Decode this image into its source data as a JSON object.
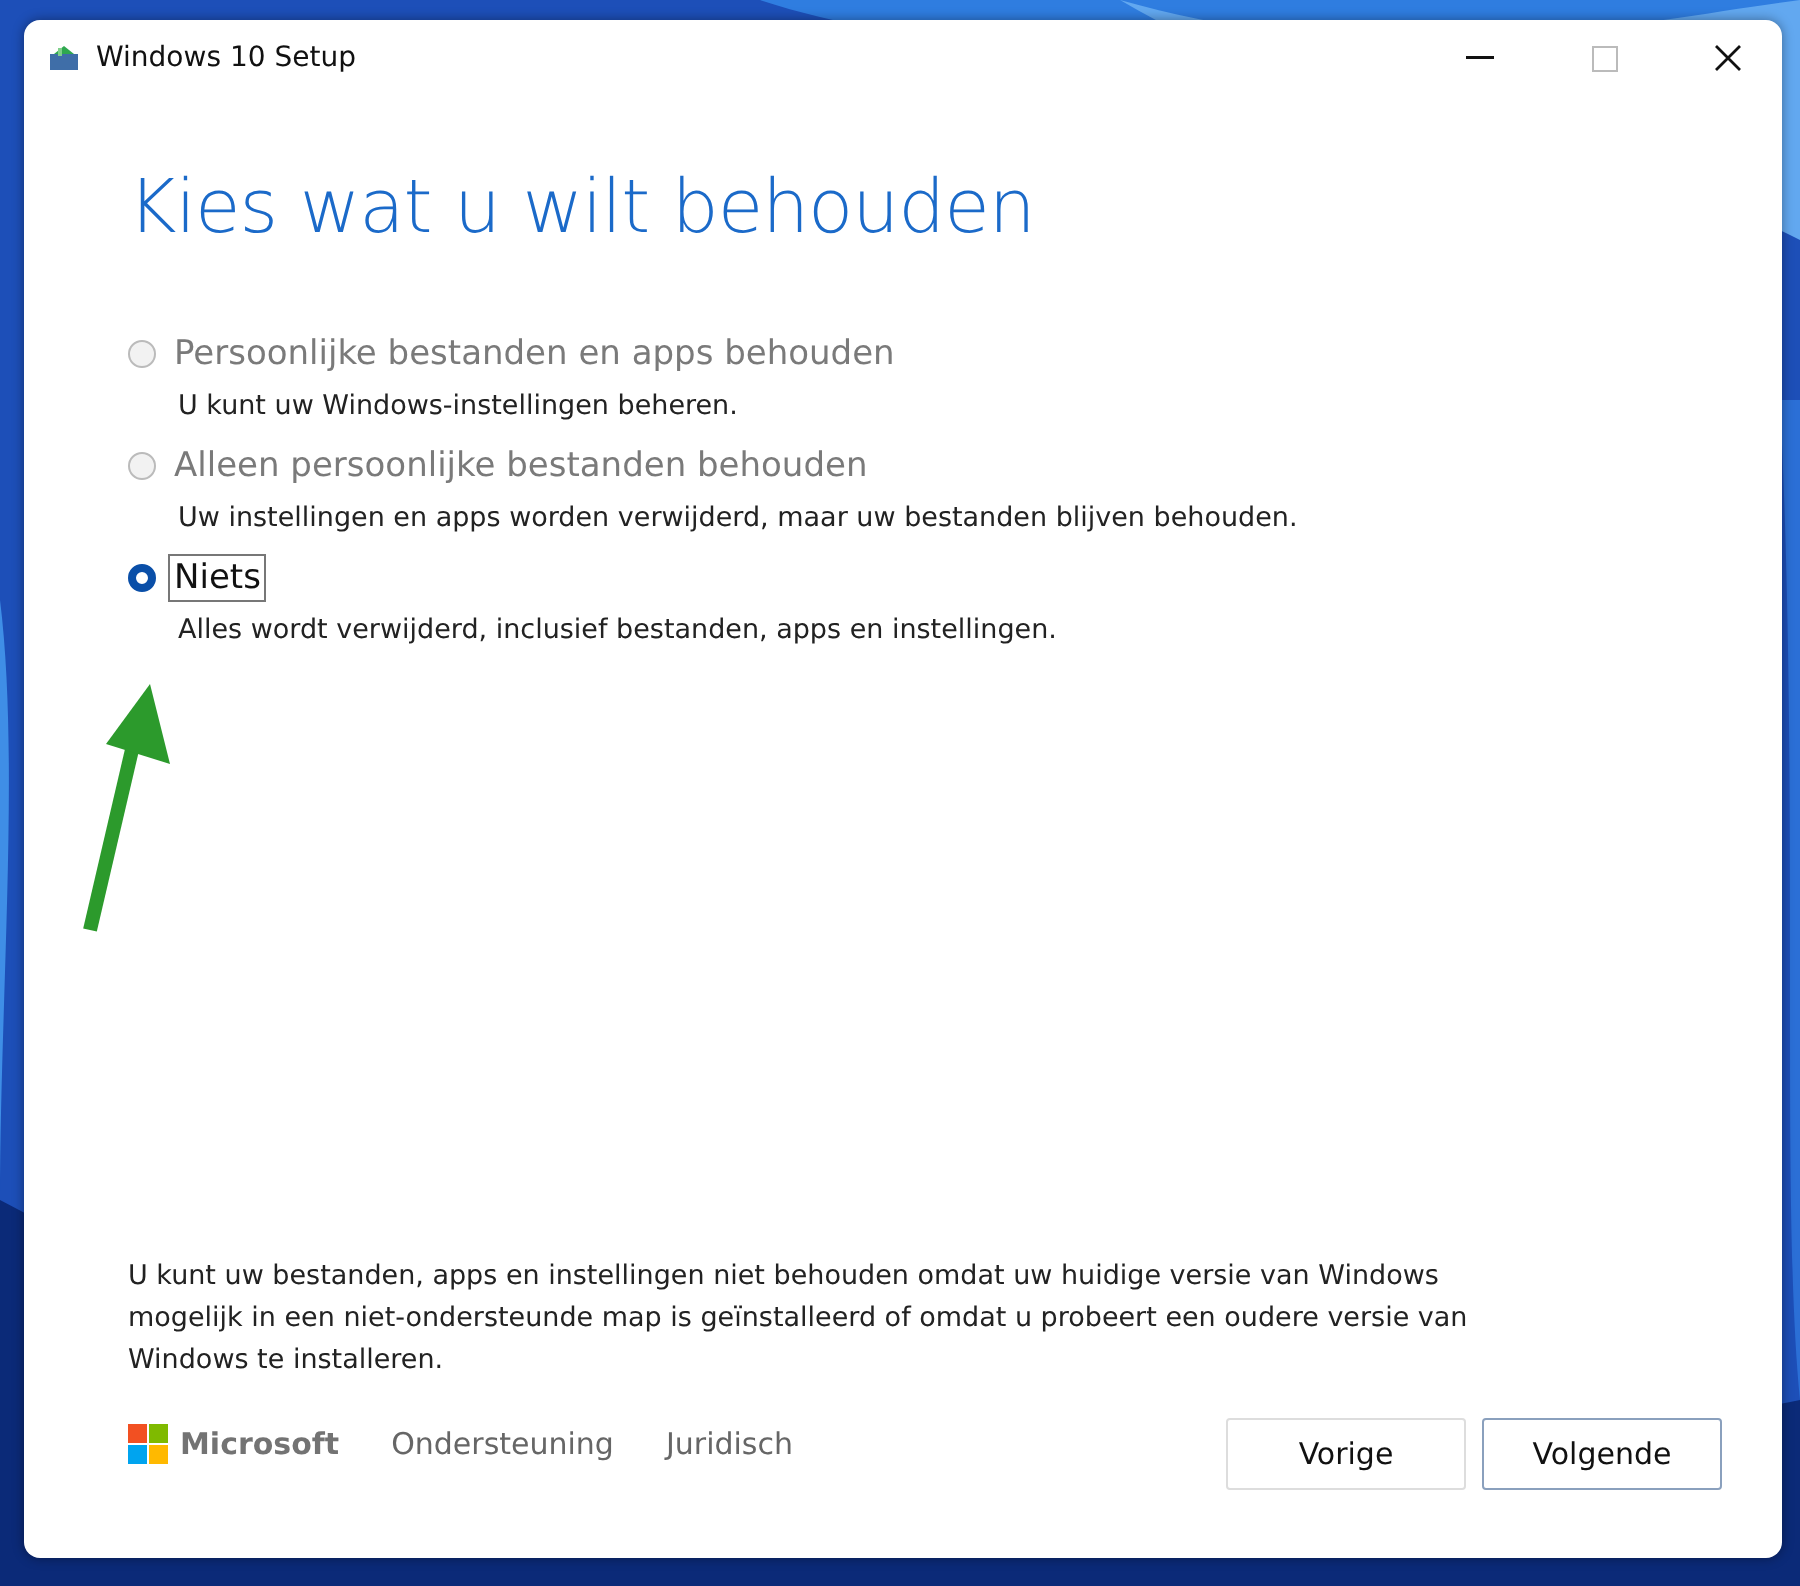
{
  "window": {
    "title": "Windows 10 Setup",
    "controls": [
      {
        "kind": "minimize",
        "disabled": false
      },
      {
        "kind": "maximize",
        "disabled": true
      },
      {
        "kind": "close",
        "disabled": false
      }
    ]
  },
  "heading": "Kies wat u wilt behouden",
  "options": [
    {
      "label": "Persoonlijke bestanden en apps behouden",
      "description": "U kunt uw Windows-instellingen beheren.",
      "selected": false,
      "disabled": true,
      "focused": false
    },
    {
      "label": "Alleen persoonlijke bestanden behouden",
      "description": "Uw instellingen en apps worden verwijderd, maar uw bestanden blijven behouden.",
      "selected": false,
      "disabled": true,
      "focused": false
    },
    {
      "label": "Niets",
      "description": "Alles wordt verwijderd, inclusief bestanden, apps en instellingen.",
      "selected": true,
      "disabled": false,
      "focused": true
    }
  ],
  "notice": "U kunt uw bestanden, apps en instellingen niet behouden omdat uw huidige versie van Windows mogelijk in een niet-ondersteunde map is geïnstalleerd of omdat u probeert een oudere versie van Windows te installeren.",
  "footer": {
    "brand": "Microsoft",
    "links": [
      "Ondersteuning",
      "Juridisch"
    ],
    "buttons": [
      {
        "label": "Vorige",
        "kind": "secondary"
      },
      {
        "label": "Volgende",
        "kind": "focused"
      }
    ]
  }
}
